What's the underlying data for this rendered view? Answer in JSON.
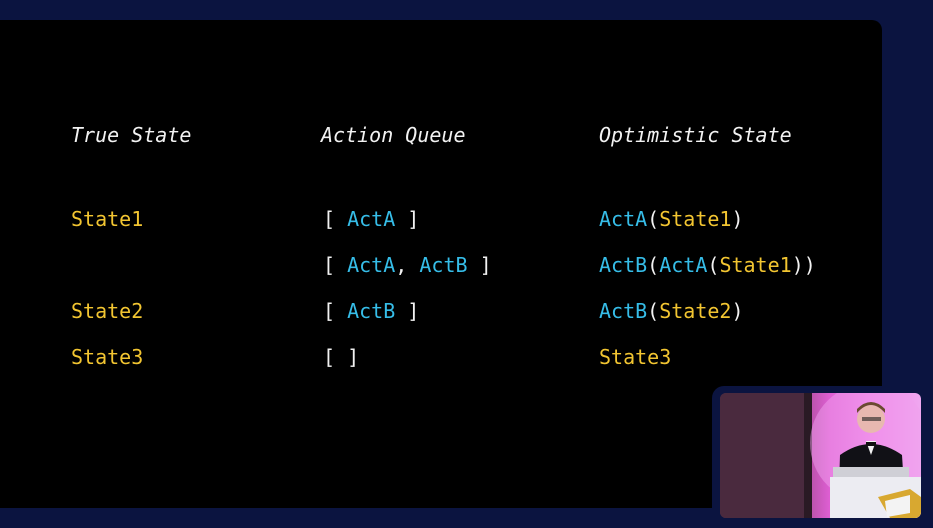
{
  "headers": {
    "true_state": "True State",
    "action_queue": "Action Queue",
    "optimistic_state": "Optimistic State"
  },
  "rows": [
    {
      "true_state": "State1",
      "queue": [
        {
          "text": "[ ",
          "color": "white"
        },
        {
          "text": "ActA",
          "color": "cyan"
        },
        {
          "text": " ]",
          "color": "white"
        }
      ],
      "optimistic": [
        {
          "text": "ActA",
          "color": "cyan"
        },
        {
          "text": "(",
          "color": "white"
        },
        {
          "text": "State1",
          "color": "yellow"
        },
        {
          "text": ")",
          "color": "white"
        }
      ]
    },
    {
      "true_state": "",
      "queue": [
        {
          "text": "[ ",
          "color": "white"
        },
        {
          "text": "ActA",
          "color": "cyan"
        },
        {
          "text": ", ",
          "color": "white"
        },
        {
          "text": "ActB",
          "color": "cyan"
        },
        {
          "text": " ]",
          "color": "white"
        }
      ],
      "optimistic": [
        {
          "text": "ActB",
          "color": "cyan"
        },
        {
          "text": "(",
          "color": "white"
        },
        {
          "text": "ActA",
          "color": "cyan"
        },
        {
          "text": "(",
          "color": "white"
        },
        {
          "text": "State1",
          "color": "yellow"
        },
        {
          "text": "))",
          "color": "white"
        }
      ]
    },
    {
      "true_state": "State2",
      "queue": [
        {
          "text": "[ ",
          "color": "white"
        },
        {
          "text": "ActB",
          "color": "cyan"
        },
        {
          "text": " ]",
          "color": "white"
        }
      ],
      "optimistic": [
        {
          "text": "ActB",
          "color": "cyan"
        },
        {
          "text": "(",
          "color": "white"
        },
        {
          "text": "State2",
          "color": "yellow"
        },
        {
          "text": ")",
          "color": "white"
        }
      ]
    },
    {
      "true_state": "State3",
      "queue": [
        {
          "text": "[ ]",
          "color": "white"
        }
      ],
      "optimistic": [
        {
          "text": "State3",
          "color": "yellow"
        }
      ]
    }
  ],
  "colors": {
    "background": "#0b1440",
    "slide": "#000000",
    "yellow": "#f2c531",
    "cyan": "#36bde8",
    "white": "#f2f2f2"
  }
}
